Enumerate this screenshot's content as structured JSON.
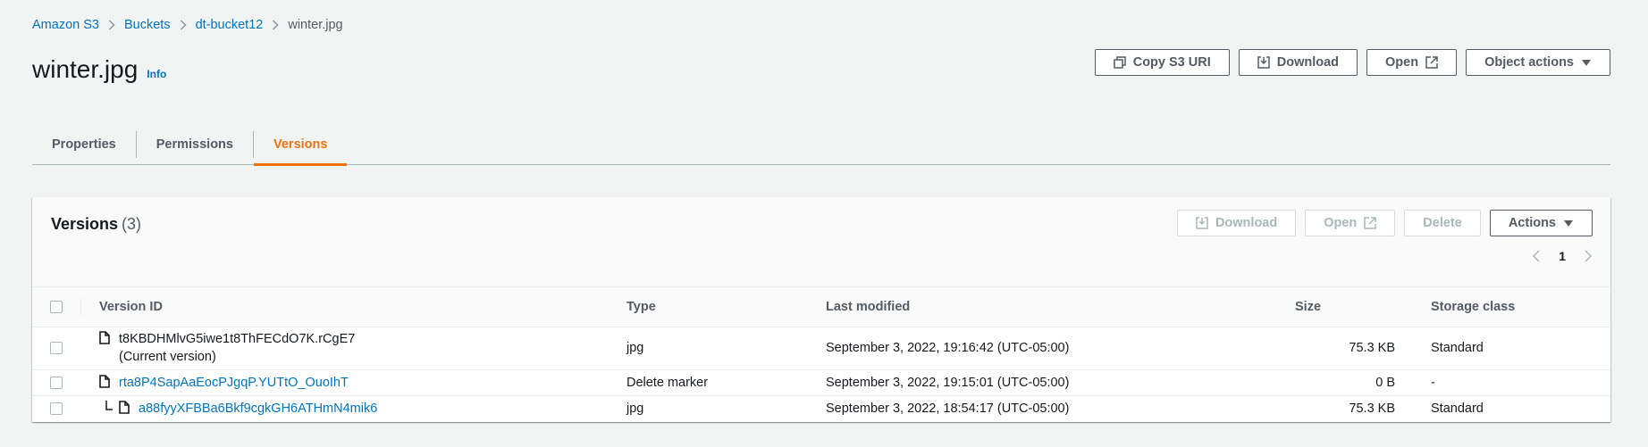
{
  "breadcrumb": {
    "items": [
      "Amazon S3",
      "Buckets",
      "dt-bucket12"
    ],
    "current": "winter.jpg"
  },
  "header": {
    "title": "winter.jpg",
    "info": "Info",
    "buttons": {
      "copy_uri": "Copy S3 URI",
      "download": "Download",
      "open": "Open",
      "object_actions": "Object actions"
    }
  },
  "tabs": [
    {
      "label": "Properties",
      "active": false
    },
    {
      "label": "Permissions",
      "active": false
    },
    {
      "label": "Versions",
      "active": true
    }
  ],
  "versions": {
    "title": "Versions",
    "count": "(3)",
    "buttons": {
      "download": "Download",
      "open": "Open",
      "delete": "Delete",
      "actions": "Actions"
    },
    "page": "1",
    "columns": {
      "version_id": "Version ID",
      "type": "Type",
      "last_modified": "Last modified",
      "size": "Size",
      "storage_class": "Storage class"
    },
    "rows": [
      {
        "version_id": "t8KBDHMlvG5iwe1t8ThFECdO7K.rCgE7",
        "note": "(Current version)",
        "type": "jpg",
        "last_modified": "September 3, 2022, 19:16:42 (UTC-05:00)",
        "size": "75.3 KB",
        "storage_class": "Standard"
      },
      {
        "version_id": "rta8P4SapAaEocPJgqP.YUTtO_OuoIhT",
        "type": "Delete marker",
        "last_modified": "September 3, 2022, 19:15:01 (UTC-05:00)",
        "size": "0 B",
        "storage_class": "-"
      },
      {
        "version_id": "a88fyyXFBBa6Bkf9cgkGH6ATHmN4mik6",
        "type": "jpg",
        "last_modified": "September 3, 2022, 18:54:17 (UTC-05:00)",
        "size": "75.3 KB",
        "storage_class": "Standard"
      }
    ]
  },
  "colors": {
    "link": "#0073bb",
    "active_tab": "#ec7211",
    "text": "#16191f",
    "muted": "#545b64",
    "disabled": "#aab7b8"
  }
}
